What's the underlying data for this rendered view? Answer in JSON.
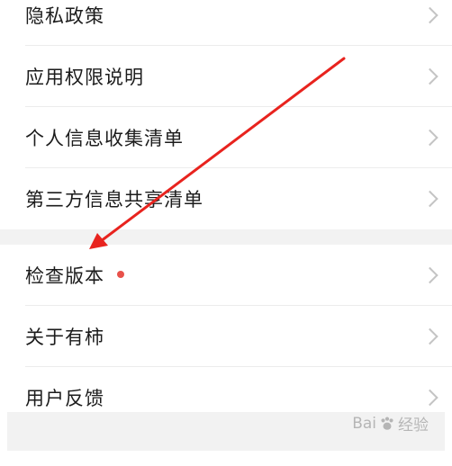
{
  "privacy_group": [
    {
      "label": "隐私政策"
    },
    {
      "label": "应用权限说明"
    },
    {
      "label": "个人信息收集清单"
    },
    {
      "label": "第三方信息共享清单"
    }
  ],
  "about_group": [
    {
      "label": "检查版本",
      "has_update_dot": true
    },
    {
      "label": "关于有柿"
    },
    {
      "label": "用户反馈"
    }
  ],
  "colors": {
    "update_dot": "#e8514a",
    "annotation_arrow": "#e8231e",
    "section_gap": "#f2f2f2"
  },
  "watermark": {
    "text_left": "Bai",
    "text_right": "经验"
  }
}
